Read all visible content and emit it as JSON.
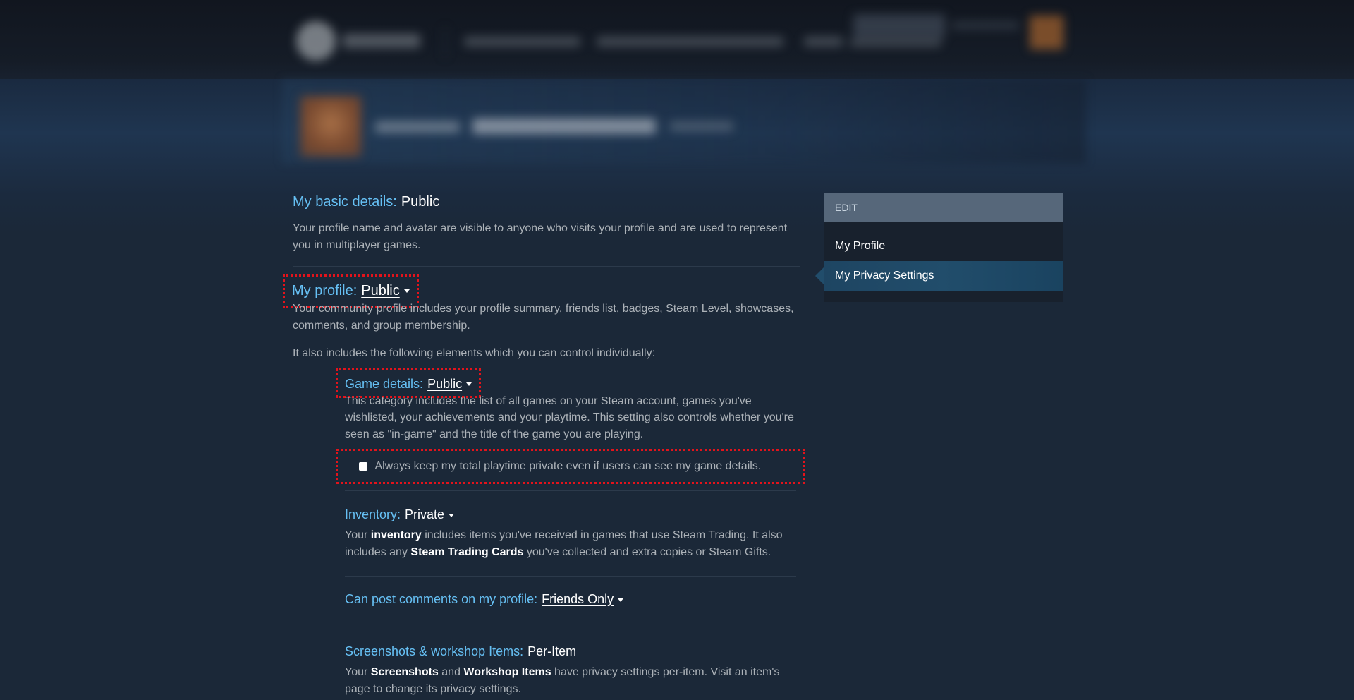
{
  "sidebar": {
    "header": "EDIT",
    "items": [
      {
        "label": "My Profile"
      },
      {
        "label": "My Privacy Settings",
        "active": true
      }
    ]
  },
  "privacy": {
    "basic": {
      "label": "My basic details:",
      "value": "Public",
      "description": "Your profile name and avatar are visible to anyone who visits your profile and are used to represent you in multiplayer games."
    },
    "profile": {
      "label": "My profile:",
      "value": "Public",
      "description": "Your community profile includes your profile summary, friends list, badges, Steam Level, showcases, comments, and group membership.",
      "also_text": "It also includes the following elements which you can control individually:"
    },
    "game_details": {
      "label": "Game details:",
      "value": "Public",
      "description": "This category includes the list of all games on your Steam account, games you've wishlisted, your achievements and your playtime. This setting also controls whether you're seen as \"in-game\" and the title of the game you are playing.",
      "checkbox_label": "Always keep my total playtime private even if users can see my game details.",
      "checkbox_checked": false
    },
    "inventory": {
      "label": "Inventory:",
      "value": "Private",
      "desc_1": "Your ",
      "desc_bold_1": "inventory",
      "desc_2": " includes items you've received in games that use Steam Trading. It also includes any ",
      "desc_bold_2": "Steam Trading Cards",
      "desc_3": " you've collected and extra copies or Steam Gifts."
    },
    "comments": {
      "label": "Can post comments on my profile:",
      "value": "Friends Only"
    },
    "screenshots": {
      "label": "Screenshots & workshop Items:",
      "value": "Per-Item",
      "desc_1": "Your ",
      "desc_bold_1": "Screenshots",
      "desc_2": " and ",
      "desc_bold_2": "Workshop Items",
      "desc_3": " have privacy settings per-item. Visit an item's page to change its privacy settings."
    }
  },
  "colors": {
    "background": "#1b2838",
    "accent_blue": "#66c0f4",
    "highlight_red": "#e4131b",
    "sidebar_header": "#56677a",
    "sidebar_active": "#214d6b"
  }
}
